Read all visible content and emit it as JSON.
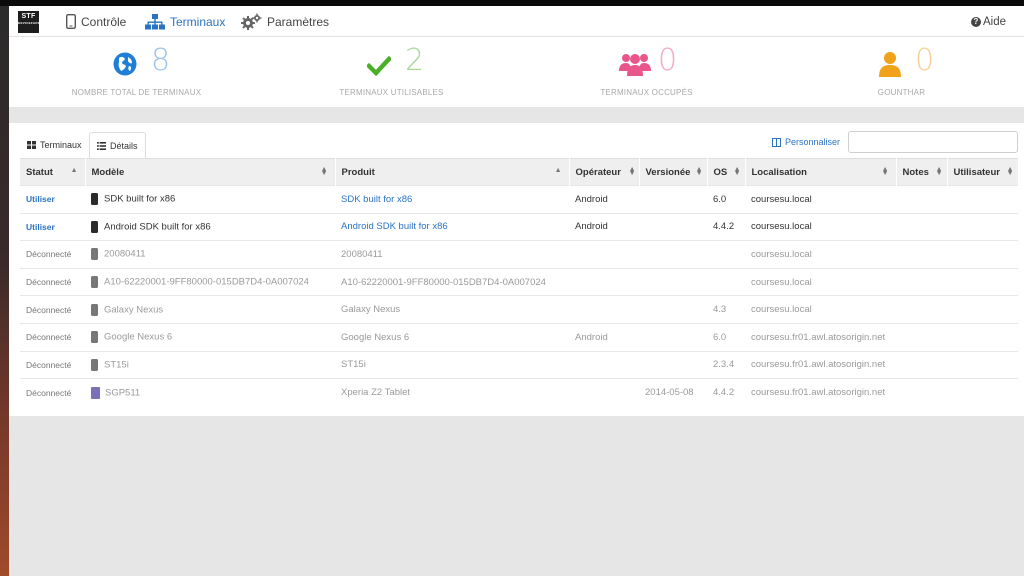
{
  "logo": {
    "line1": "STF",
    "line2": "DEVICEFARM"
  },
  "nav": {
    "controle": "Contrôle",
    "terminaux": "Terminaux",
    "parametres": "Paramètres",
    "aide": "Aide"
  },
  "stats": [
    {
      "value": "8",
      "label": "NOMBRE TOTAL DE TERMINAUX",
      "icon": "globe-icon",
      "color": "#1f7fd6"
    },
    {
      "value": "2",
      "label": "TERMINAUX UTILISABLES",
      "icon": "check-icon",
      "color": "#4caf28"
    },
    {
      "value": "0",
      "label": "TERMINAUX OCCUPÉS",
      "icon": "users-icon",
      "color": "#e8568a"
    },
    {
      "value": "0",
      "label": "GOUNTHAR",
      "icon": "user-icon",
      "color": "#f0a21a"
    }
  ],
  "tabs": {
    "terminaux": "Terminaux",
    "details": "Détails"
  },
  "personnaliser": "Personnaliser",
  "search": {
    "value": "",
    "placeholder": ""
  },
  "table": {
    "headers": {
      "statut": "Statut",
      "modele": "Modèle",
      "produit": "Produit",
      "operateur": "Opérateur",
      "versionee": "Versionée",
      "os": "OS",
      "localisation": "Localisation",
      "notes": "Notes",
      "utilisateur": "Utilisateur"
    },
    "rows": [
      {
        "status": "Utiliser",
        "model": "SDK built for x86",
        "product": "SDK built for x86",
        "operator": "Android",
        "version": "",
        "os": "6.0",
        "location": "coursesu.local",
        "notes": "",
        "user": ""
      },
      {
        "status": "Utiliser",
        "model": "Android SDK built for x86",
        "product": "Android SDK built for x86",
        "operator": "Android",
        "version": "",
        "os": "4.4.2",
        "location": "coursesu.local",
        "notes": "",
        "user": ""
      },
      {
        "status": "Déconnecté",
        "model": "20080411",
        "product": "20080411",
        "operator": "",
        "version": "",
        "os": "",
        "location": "coursesu.local",
        "notes": "",
        "user": ""
      },
      {
        "status": "Déconnecté",
        "model": "A10-62220001-9FF80000-015DB7D4-0A007024",
        "product": "A10-62220001-9FF80000-015DB7D4-0A007024",
        "operator": "",
        "version": "",
        "os": "",
        "location": "coursesu.local",
        "notes": "",
        "user": ""
      },
      {
        "status": "Déconnecté",
        "model": "Galaxy Nexus",
        "product": "Galaxy Nexus",
        "operator": "",
        "version": "",
        "os": "4.3",
        "location": "coursesu.local",
        "notes": "",
        "user": ""
      },
      {
        "status": "Déconnecté",
        "model": "Google Nexus 6",
        "product": "Google Nexus 6",
        "operator": "Android",
        "version": "",
        "os": "6.0",
        "location": "coursesu.fr01.awl.atosorigin.net",
        "notes": "",
        "user": ""
      },
      {
        "status": "Déconnecté",
        "model": "ST15i",
        "product": "ST15i",
        "operator": "",
        "version": "",
        "os": "2.3.4",
        "location": "coursesu.fr01.awl.atosorigin.net",
        "notes": "",
        "user": ""
      },
      {
        "status": "Déconnecté",
        "model": "SGP511",
        "product": "Xperia Z2 Tablet",
        "operator": "",
        "version": "2014-05-08",
        "os": "4.4.2",
        "location": "coursesu.fr01.awl.atosorigin.net",
        "notes": "",
        "user": ""
      }
    ]
  }
}
